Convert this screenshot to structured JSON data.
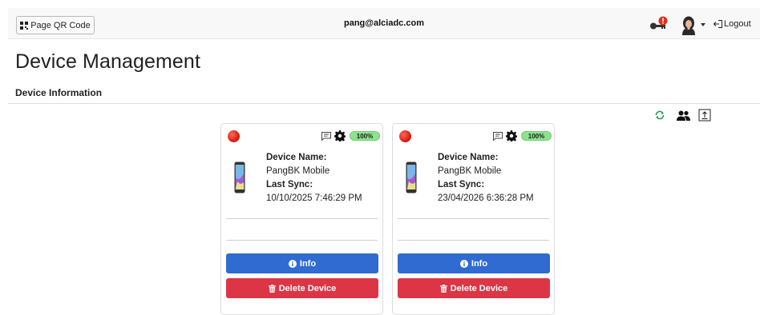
{
  "header": {
    "qr_button_label": "Page QR Code",
    "user_email": "pang@alciadc.com",
    "logout_label": "Logout"
  },
  "page": {
    "title": "Device Management",
    "section_title": "Device Information"
  },
  "toolbar_icons": [
    "refresh-icon",
    "users-icon",
    "export-icon"
  ],
  "labels": {
    "device_name": "Device Name:",
    "last_sync": "Last Sync:",
    "info_button": "Info",
    "delete_button": "Delete Device"
  },
  "devices": [
    {
      "name": "PangBK Mobile",
      "last_sync": "10/10/2025 7:46:29 PM",
      "battery": "100%",
      "status": "offline"
    },
    {
      "name": "PangBK Mobile",
      "last_sync": "23/04/2026 6:36:28 PM",
      "battery": "100%",
      "status": "offline"
    }
  ],
  "colors": {
    "info_button": "#2f6bd0",
    "delete_button": "#dc3545",
    "status_offline": "#d4140a",
    "battery_badge": "#8de38d",
    "refresh_icon": "#1e9b4a"
  }
}
